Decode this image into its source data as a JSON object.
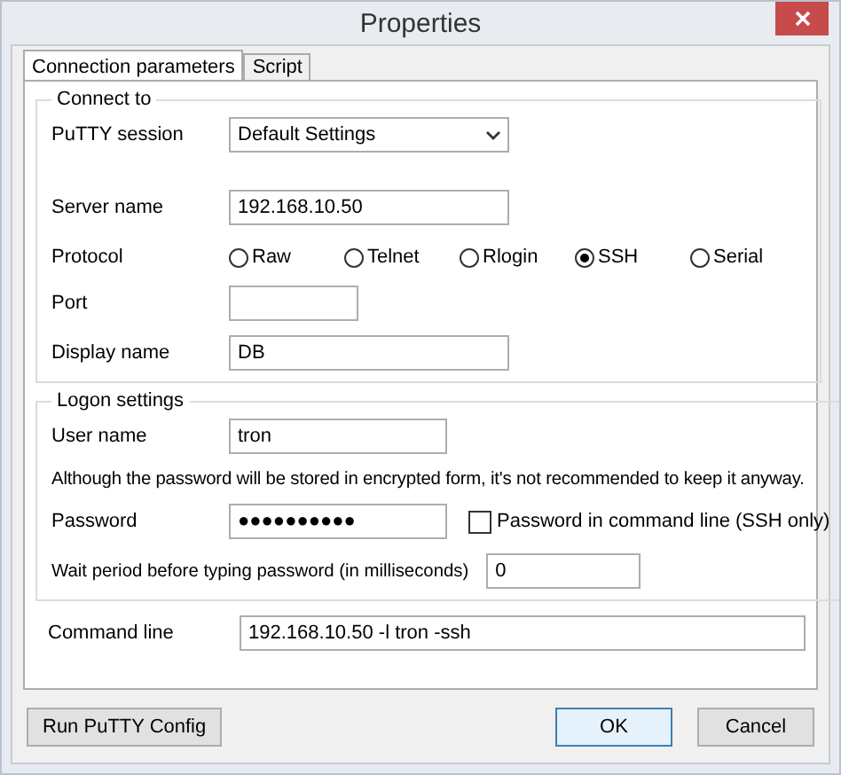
{
  "window": {
    "title": "Properties"
  },
  "tabs": [
    {
      "label": "Connection parameters",
      "selected": true
    },
    {
      "label": "Script",
      "selected": false
    }
  ],
  "connect_to": {
    "title": "Connect to",
    "putty_session": {
      "label": "PuTTY session",
      "value": "Default Settings"
    },
    "server_name": {
      "label": "Server name",
      "value": "192.168.10.50"
    },
    "protocol": {
      "label": "Protocol",
      "options": [
        {
          "label": "Raw",
          "selected": false
        },
        {
          "label": "Telnet",
          "selected": false
        },
        {
          "label": "Rlogin",
          "selected": false
        },
        {
          "label": "SSH",
          "selected": true
        },
        {
          "label": "Serial",
          "selected": false
        }
      ]
    },
    "port": {
      "label": "Port"
    },
    "display_name": {
      "label": "Display name",
      "value": "DB"
    }
  },
  "logon_settings": {
    "title": "Logon settings",
    "user_name": {
      "label": "User name",
      "value": "tron"
    },
    "note": "Although the password will be stored in encrypted form, it's not recommended to keep it anyway.",
    "password": {
      "label": "Password",
      "value": "●●●●●●●●●●"
    },
    "password_in_command_line": {
      "label": "Password in command line (SSH only)",
      "checked": false
    },
    "wait_period": {
      "label": "Wait period before typing password (in milliseconds)",
      "value": "0"
    }
  },
  "command_line": {
    "label": "Command line",
    "value": "192.168.10.50  -l tron -ssh"
  },
  "buttons": [
    {
      "label": "Run PuTTY Config",
      "kind": "secondary"
    },
    {
      "label": "OK",
      "kind": "default"
    },
    {
      "label": "Cancel",
      "kind": "secondary"
    }
  ]
}
